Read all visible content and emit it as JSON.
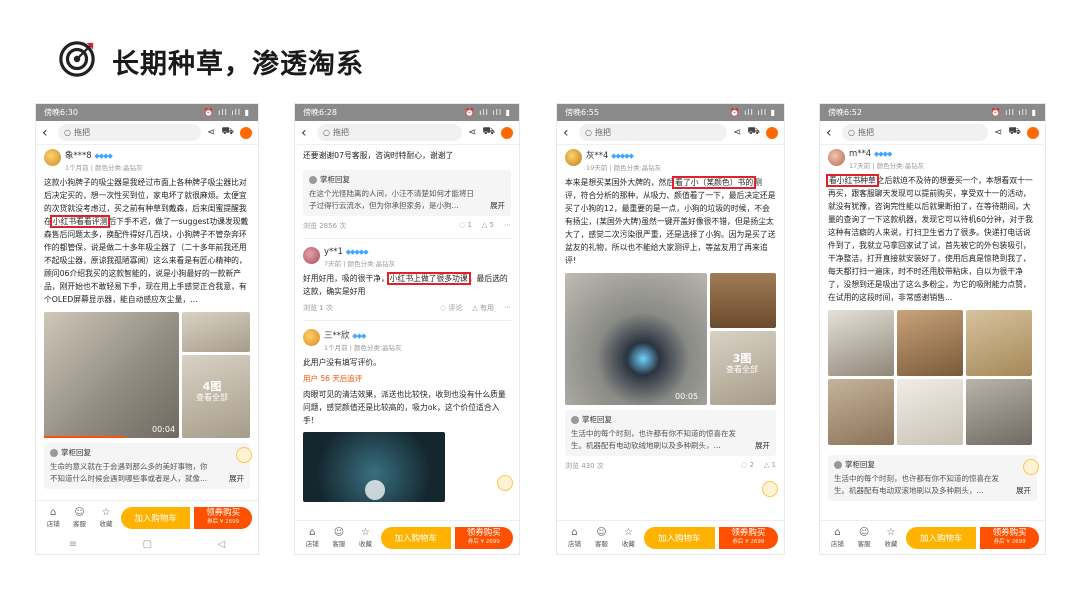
{
  "header": {
    "title": "长期种草，渗透淘系",
    "icon": "target-icon"
  },
  "common": {
    "search_placeholder": "拖把",
    "store": "店铺",
    "service": "客服",
    "fav": "收藏",
    "add_cart": "加入购物车",
    "buy": "领券购买",
    "buy_price": "券后 ¥ 2699",
    "reply_head": "掌柜回复",
    "expand": "展开",
    "accent": "#ff5000",
    "highlight": "#e0202a"
  },
  "phones": [
    {
      "time": "傍晚6:30",
      "user": "象***8",
      "meta": "1个月前 | 颜色分类:晶钻灰",
      "text_pre": "这款小狗牌子的吸尘器是我经过市面上各种牌子吸尘器比对后决定买的，想一次性买到位，家电坏了就很麻烦。太便宜的次货就没考虑过，买之前有种草到戴森，后来闺蜜提醒我在",
      "highlight": "小红书看看评测",
      "text_post": "后下手不迟，做了一suggest功课发现戴森售后问题太多，换配件得好几百块，小狗牌子不管杂奔环作的都管保，说是做二十多年吸尘器了（二十多年前我还用不起吸尘器，原谅我孤陋寡闻）这么来看是有匠心精神的，顾问06介绍我买的这款智能的，说是小狗最好的一款新产品，刚开始也不敢轻易下手，现在用上手感觉正合我意，有个OLED屏幕显示器，能自动感应灰尘量，...",
      "video_time": "00:04",
      "more_count": "4图",
      "more_label": "查看全部",
      "reply": "生命的意义就在于会遇到那么多的美好事物，你不知道什么时候会遇到哪些事或者是人，就像...",
      "expand": "展开"
    },
    {
      "time": "傍晚6:28",
      "top_text": "还要谢谢07号客服，咨询时特耐心，谢谢了",
      "reply1": "在这个光怪陆离的人间，小汪不清楚如何才能将日子过得行云流水，但为你承担家务，是小狗...",
      "views1": "浏览 2856 次",
      "stat1a": "1",
      "stat1b": "5",
      "user2": "y**1",
      "meta2": "7天前 | 颜色分类:晶钻灰",
      "text2_pre": "好用好用，吸的很干净，",
      "highlight": "小红书上做了很多功课",
      "text2_post": "，最后选的这款，确实是好用",
      "views2": "浏览 1 次",
      "stat2a": "评论",
      "stat2b": "有用",
      "user3": "三**欣",
      "meta3": "1个月前 | 颜色分类:晶钻灰",
      "text3": "此用户没有填写评价。",
      "append_label": "用户 56 天后追评",
      "text3b": "肉眼可见的清洁效果，派送也比较快，收到也没有什么质量问题，感觉颜值还是比较高的，吸力ok，这个价位适合入手！"
    },
    {
      "time": "傍晚6:55",
      "user": "灰**4",
      "meta": "19天前 | 颜色分类:晶钻灰",
      "text_pre": "本来是想买某国外大牌的，然后",
      "highlight": "看了小（某颜色）书的",
      "text_post": "测评，符合分析的那种，从吸力、颜值看了一下，最后决定还是买了小狗的12，最重要的是一点，小狗的垃圾的时候，不会有扬尘，(某国外大牌)虽然一键开盖好像很不错，但是扬尘太大了，感觉二次污染很严重，还是选择了小狗。因为是买了送盆友的礼物，所以也不能给大家测评上，等盆友用了再来追评！",
      "video_time": "00:05",
      "more_count": "3图",
      "more_label": "查看全部",
      "reply": "生活中的每个时刻，也许都有你不知道的惊喜在发生。机器配有电动软绒地刷以及多种刷头，...",
      "expand": "展开",
      "views": "浏览 430 次",
      "stat_a": "2",
      "stat_b": "1"
    },
    {
      "time": "傍晚6:52",
      "user": "m**4",
      "meta": "17天前 | 颜色分类:晶钻灰",
      "highlight": "看小红书种草",
      "text_post": "之后就迫不及待的想要买一个，本想看双十一再买，跟客服聊天发现可以提前购买，享受双十一的活动，就没有犹豫，咨询完性能以后就果断拍了，在等待期间，大量的查询了一下这款机器，发现它可以待机60分钟，对于我这种有洁癖的人来说，打扫卫生省力了很多。快递打电话说件到了，我就立马拿回家试了试，首先被它的外包装吸引，干净整洁，打开直接就安装好了，使用后真是惊艳到我了，每天都打扫一遍床，时不时还用胶带粘床，自以为很干净了，没想到还是吸出了这么多粉尘，为它的吸附能力点赞，在试用的这段时间，非常感谢销售...",
      "reply": "生活中的每个时刻，也许都有你不知道的惊喜在发生。机器配有电动双滚地刷以及多种刷头，...",
      "expand": "展开"
    }
  ]
}
